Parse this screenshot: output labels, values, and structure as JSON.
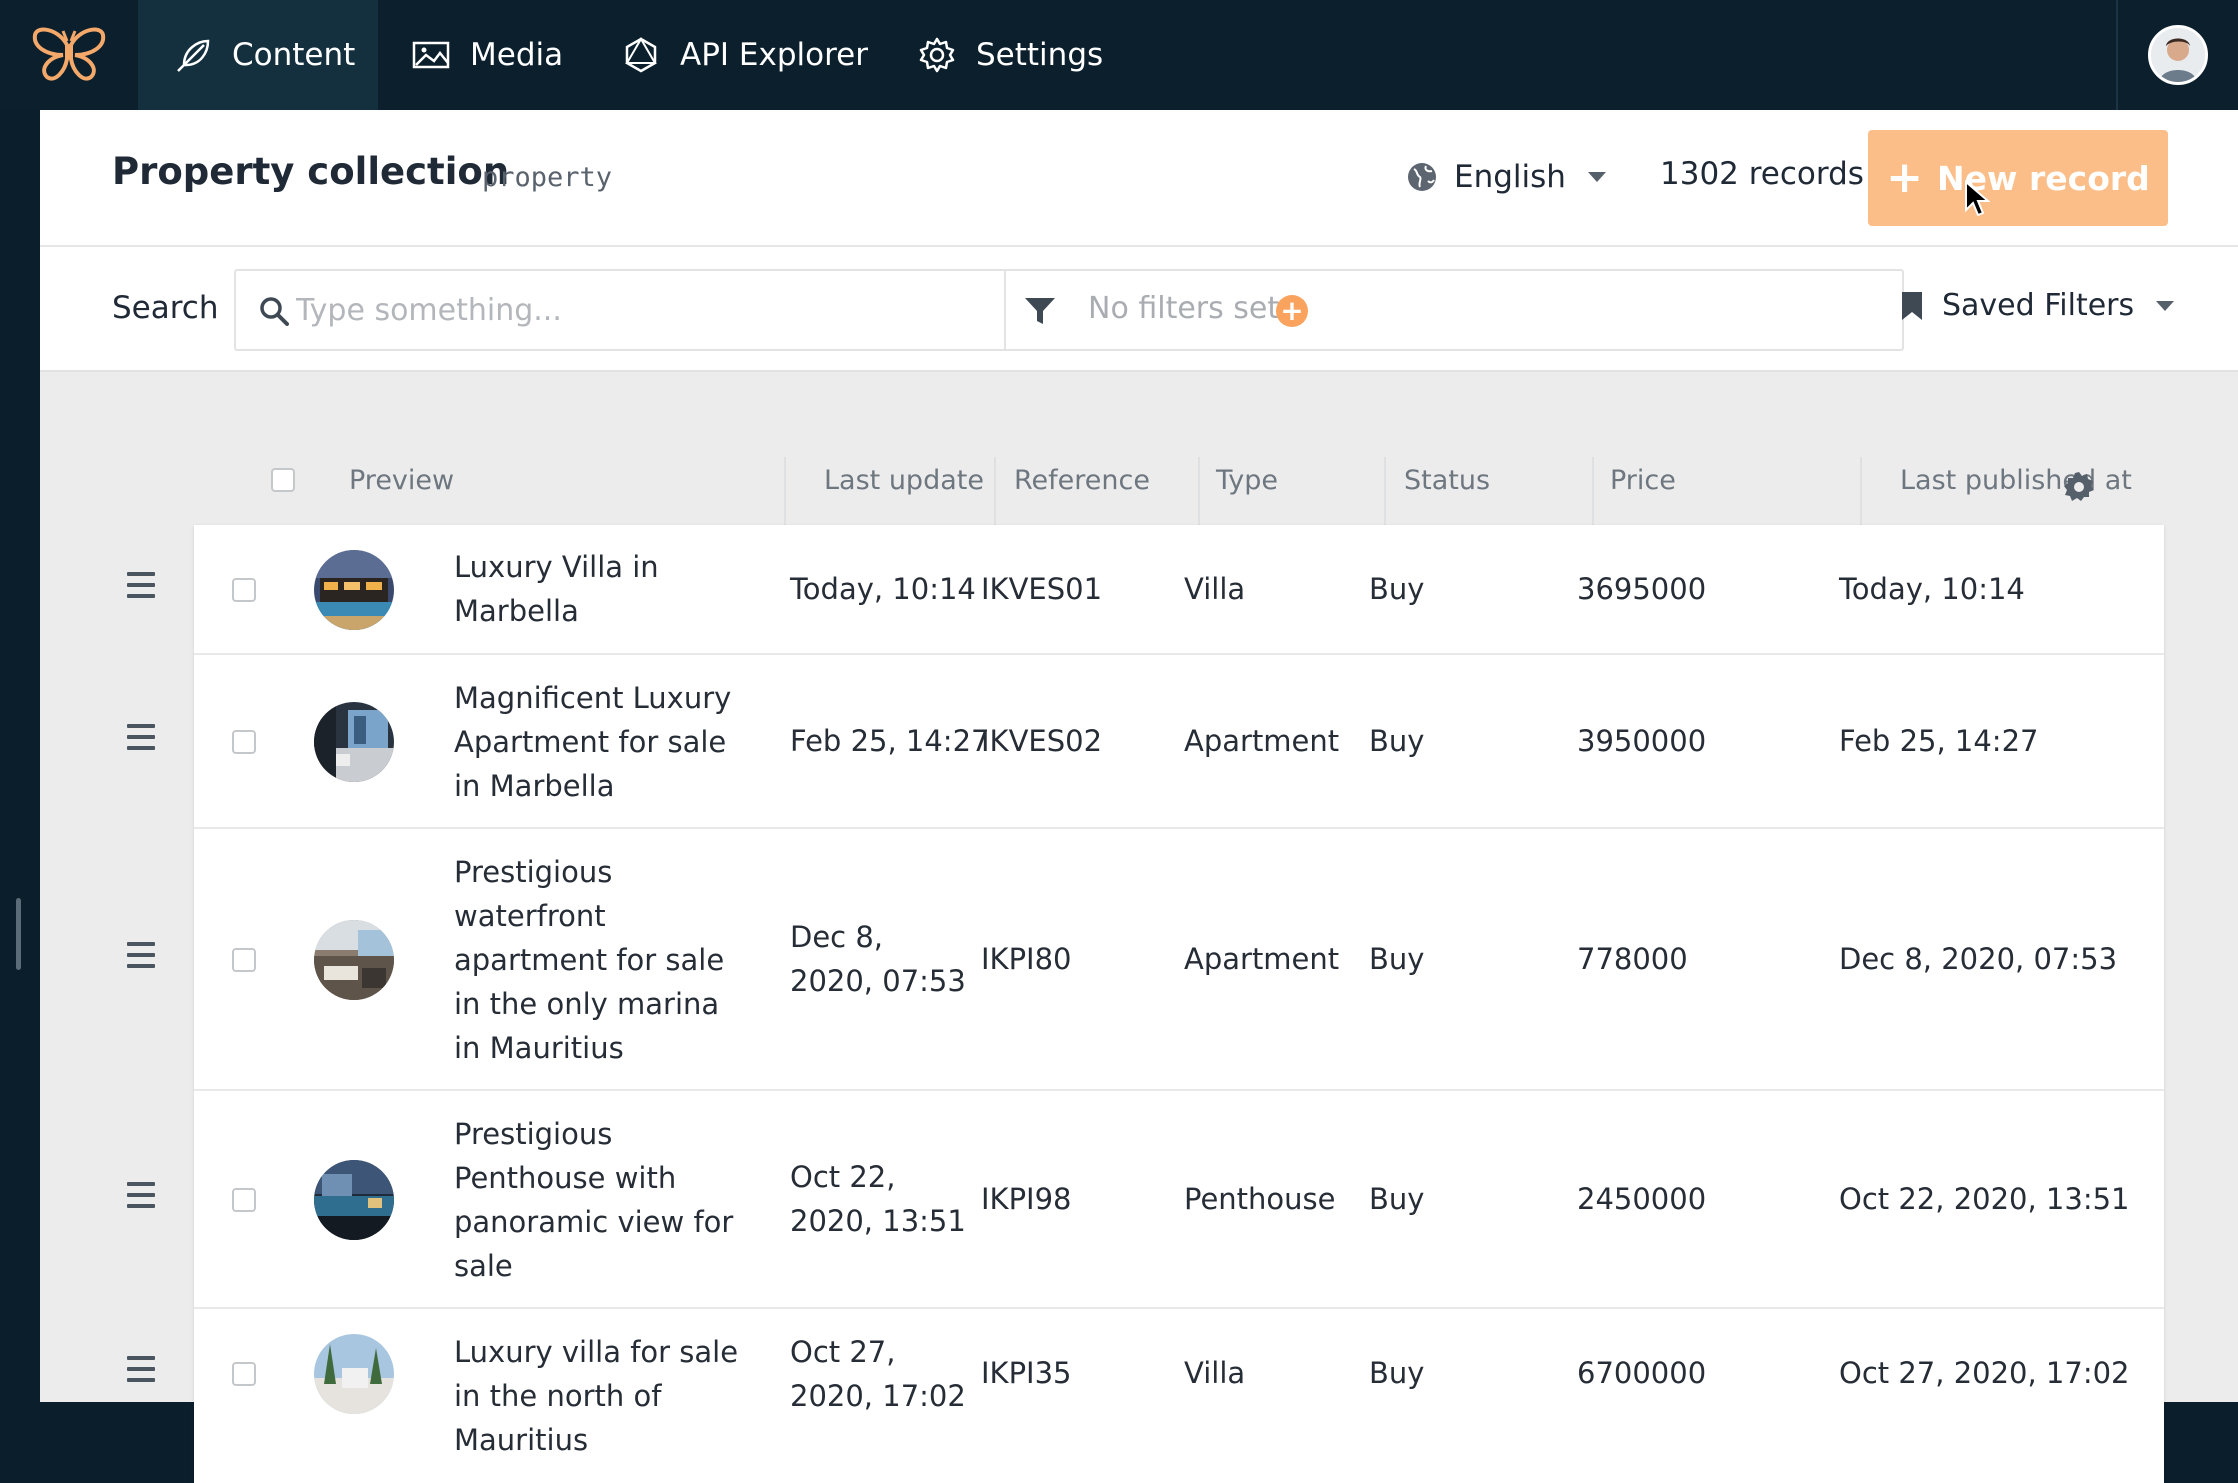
{
  "nav": {
    "items": [
      {
        "label": "Content",
        "icon": "feather-icon"
      },
      {
        "label": "Media",
        "icon": "image-icon"
      },
      {
        "label": "API Explorer",
        "icon": "graphql-icon"
      },
      {
        "label": "Settings",
        "icon": "gear-icon"
      }
    ]
  },
  "header": {
    "title": "Property collection",
    "api_key": "property",
    "language": "English",
    "record_count": "1302 records",
    "new_record_label": "New record"
  },
  "search": {
    "label": "Search",
    "placeholder": "Type something...",
    "filters_text": "No filters set",
    "saved_filters_label": "Saved Filters"
  },
  "table": {
    "columns": [
      "Preview",
      "Last update",
      "Reference",
      "Type",
      "Status",
      "Price",
      "Last published at"
    ],
    "rows": [
      {
        "title": "Luxury Villa in Marbella",
        "last_update": "Today, 10:14",
        "reference": "IKVES01",
        "type": "Villa",
        "status": "Buy",
        "price": "3695000",
        "published": "Today, 10:14"
      },
      {
        "title": "Magnificent Luxury Apartment for sale in Marbella",
        "last_update": "Feb 25, 14:27",
        "reference": "IKVES02",
        "type": "Apartment",
        "status": "Buy",
        "price": "3950000",
        "published": "Feb 25, 14:27"
      },
      {
        "title": "Prestigious waterfront apartment for sale in the only marina in Mauritius",
        "last_update": "Dec 8, 2020, 07:53",
        "reference": "IKPI80",
        "type": "Apartment",
        "status": "Buy",
        "price": "778000",
        "published": "Dec 8, 2020, 07:53"
      },
      {
        "title": "Prestigious Penthouse with panoramic view for sale",
        "last_update": "Oct 22, 2020, 13:51",
        "reference": "IKPI98",
        "type": "Penthouse",
        "status": "Buy",
        "price": "2450000",
        "published": "Oct 22, 2020, 13:51"
      },
      {
        "title": "Luxury villa for sale in the north of Mauritius",
        "last_update": "Oct 27, 2020, 17:02",
        "reference": "IKPI35",
        "type": "Villa",
        "status": "Buy",
        "price": "6700000",
        "published": "Oct 27, 2020, 17:02"
      }
    ]
  },
  "colors": {
    "nav_bg": "#0b1f2c",
    "accent": "#fbbe89",
    "add_filter": "#f9a35e"
  }
}
